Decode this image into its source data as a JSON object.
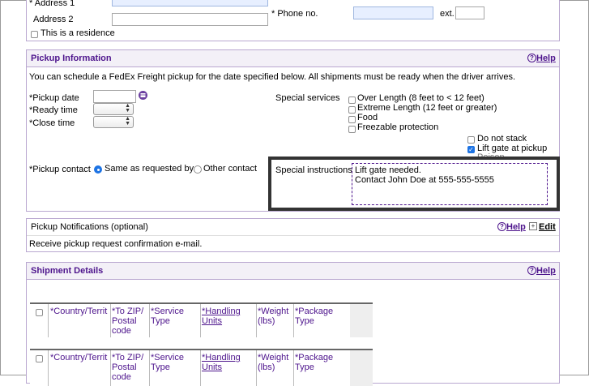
{
  "address": {
    "address1_label": "* Address 1",
    "address2_label": "Address 2",
    "residence_label": "This is a residence",
    "phone_label": "* Phone no.",
    "ext_label": "ext."
  },
  "pickup": {
    "title": "Pickup Information",
    "help": "Help",
    "intro": "You can schedule a FedEx Freight pickup for the date specified below. All shipments must be ready when the driver arrives.",
    "pickup_date_label": "*Pickup date",
    "ready_time_label": "*Ready time",
    "close_time_label": "*Close time",
    "special_services_label": "Special services",
    "services": [
      "Over Length (8 feet to < 12 feet)",
      "Extreme Length (12 feet or greater)",
      "Food",
      "Freezable protection"
    ],
    "do_not_stack": "Do not stack",
    "lift_gate": "Lift gate at pickup",
    "hidden_option": "Poison",
    "contact_label": "*Pickup contact",
    "contact_same": "Same as requested by",
    "contact_other": "Other contact",
    "special_instructions_label": "Special instructions",
    "instructions_line1": "Lift gate needed.",
    "instructions_line2": "Contact John Doe at 555-555-5555"
  },
  "notifications": {
    "title": "Pickup Notifications (optional)",
    "help": "Help",
    "edit": "Edit",
    "text": "Receive pickup request confirmation e-mail."
  },
  "shipment": {
    "title": "Shipment Details",
    "help": "Help",
    "columns": [
      "*Country/Territ",
      "*To ZIP/ Postal code",
      "*Service Type",
      "*Handling Units",
      "*Weight (lbs)",
      "*Package Type"
    ]
  }
}
